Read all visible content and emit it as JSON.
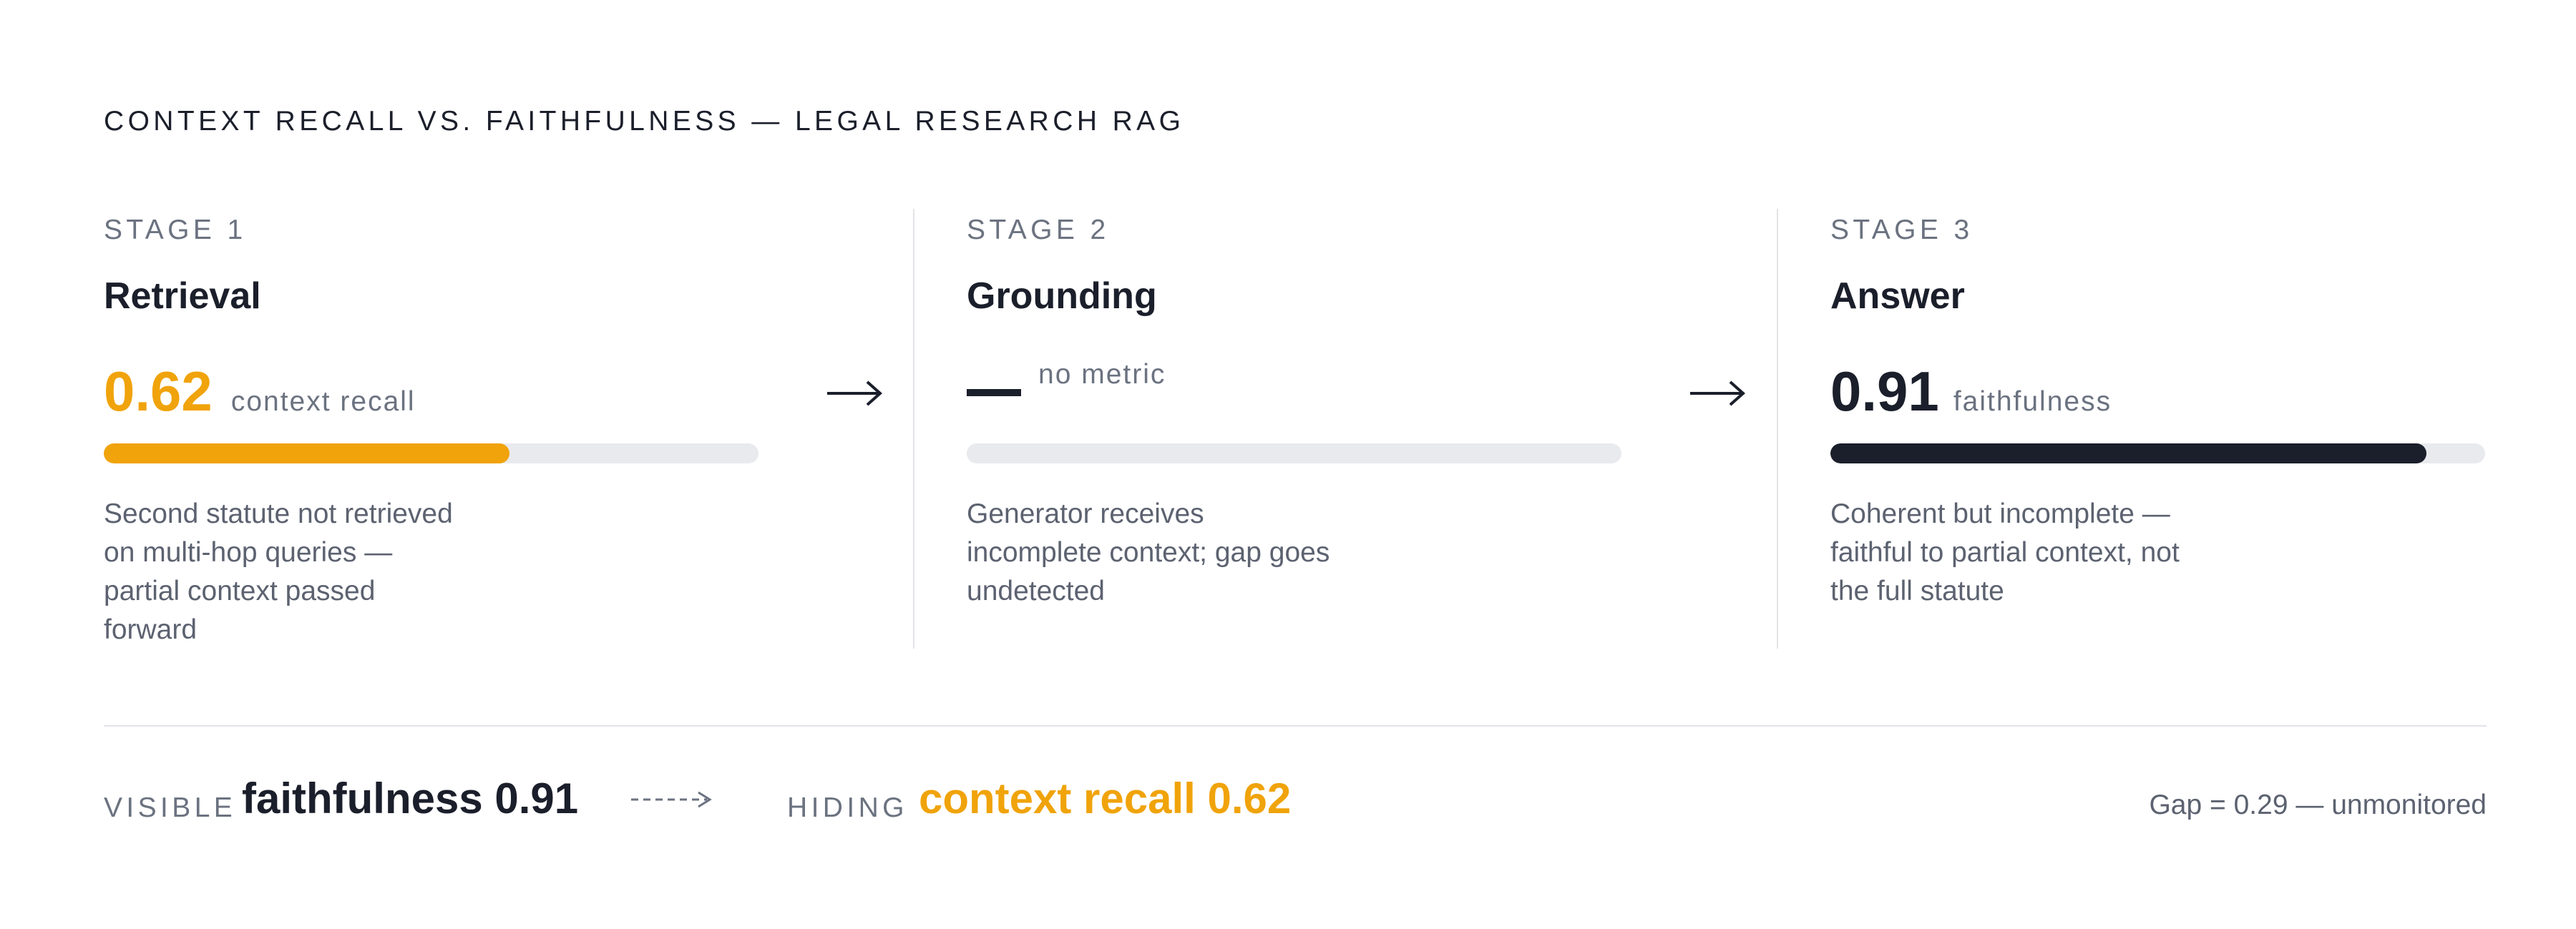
{
  "title": "CONTEXT RECALL VS. FAITHFULNESS — LEGAL RESEARCH RAG",
  "colors": {
    "accent": "#f0a30a",
    "dark": "#1b1f2b",
    "track": "#e9eaee",
    "muted": "#6b7280"
  },
  "stages": [
    {
      "stage_label": "STAGE 1",
      "name": "Retrieval",
      "metric_value": "0.62",
      "metric_label": "context recall",
      "bar_fraction": 0.62,
      "bar_color": "#f0a30a",
      "description": "Second statute not retrieved on multi-hop queries — partial context passed forward"
    },
    {
      "stage_label": "STAGE 2",
      "name": "Grounding",
      "metric_value": "",
      "metric_label": "no metric",
      "bar_fraction": 0,
      "bar_color": "#e9eaee",
      "description": "Generator receives incomplete context; gap goes undetected"
    },
    {
      "stage_label": "STAGE 3",
      "name": "Answer",
      "metric_value": "0.91",
      "metric_label": "faithfulness",
      "bar_fraction": 0.91,
      "bar_color": "#1b1f2b",
      "description": "Coherent but incomplete — faithful to partial context, not the full statute"
    }
  ],
  "footer": {
    "visible_label": "VISIBLE",
    "visible_value": "faithfulness 0.91",
    "hiding_label": "HIDING",
    "hiding_value": "context recall 0.62",
    "gap_text": "Gap = 0.29 — unmonitored"
  }
}
